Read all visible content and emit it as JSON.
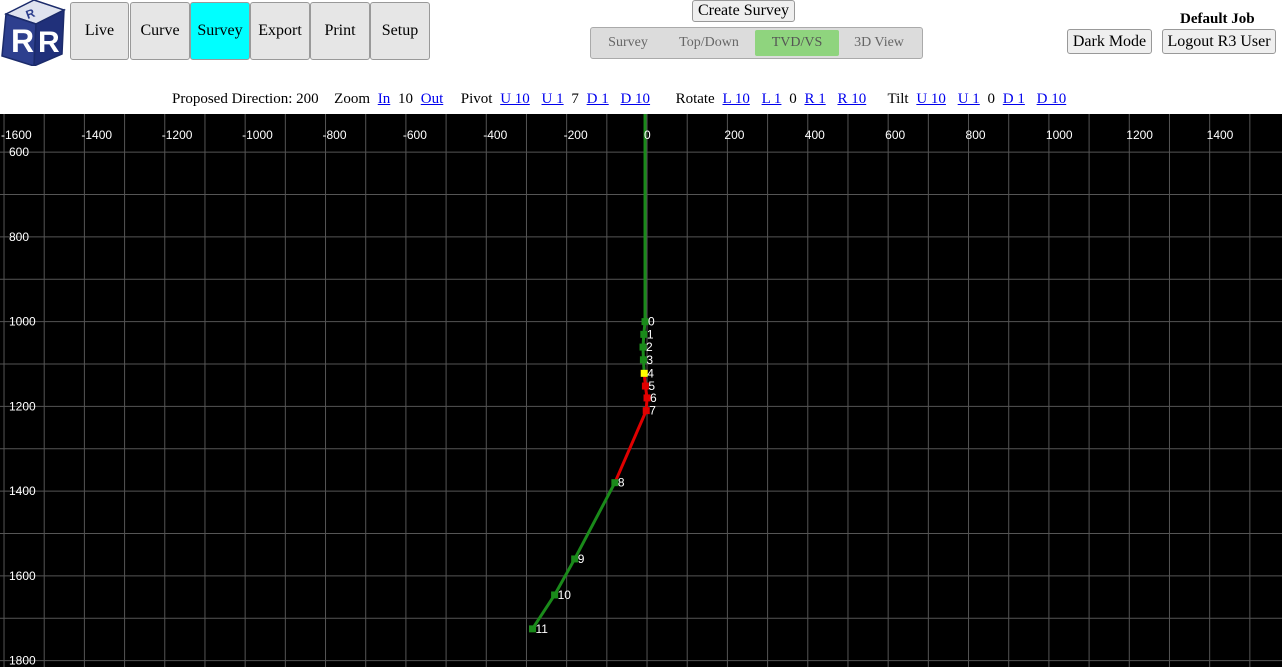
{
  "logo": {
    "letters": "RR"
  },
  "nav": {
    "items": [
      {
        "label": "Live",
        "active": false
      },
      {
        "label": "Curve",
        "active": false
      },
      {
        "label": "Survey",
        "active": true
      },
      {
        "label": "Export",
        "active": false
      },
      {
        "label": "Print",
        "active": false
      },
      {
        "label": "Setup",
        "active": false
      }
    ]
  },
  "toolbar": {
    "create_survey": "Create Survey",
    "views": [
      {
        "label": "Survey",
        "active": false
      },
      {
        "label": "Top/Down",
        "active": false
      },
      {
        "label": "TVD/VS",
        "active": true
      },
      {
        "label": "3D View",
        "active": false
      }
    ]
  },
  "header_right": {
    "job_title": "Default Job",
    "dark_mode": "Dark Mode",
    "logout": "Logout R3 User"
  },
  "controls": {
    "proposed_label": "Proposed Direction:",
    "proposed_value": "200",
    "zoom_label": "Zoom",
    "zoom_in": "In",
    "zoom_value": "10",
    "zoom_out": "Out",
    "pivot_label": "Pivot",
    "pivot_u10": "U 10",
    "pivot_u1": "U 1",
    "pivot_value": "7",
    "pivot_d1": "D 1",
    "pivot_d10": "D 10",
    "rotate_label": "Rotate",
    "rotate_l10": "L 10",
    "rotate_l1": "L 1",
    "rotate_value": "0",
    "rotate_r1": "R 1",
    "rotate_r10": "R 10",
    "tilt_label": "Tilt",
    "tilt_u10": "U 10",
    "tilt_u1": "U 1",
    "tilt_value": "0",
    "tilt_d1": "D 1",
    "tilt_d10": "D 10"
  },
  "colors": {
    "grid": "#555555",
    "path_green": "#1a8a1a",
    "path_red": "#e00000",
    "highlight": "#ffff00",
    "label": "#ffffff",
    "active_nav": "#00ffff",
    "active_view": "#8fd47e"
  },
  "chart_data": {
    "type": "line",
    "x_ticks": [
      -1600,
      -1400,
      -1200,
      -1000,
      -800,
      -600,
      -400,
      -200,
      0,
      200,
      400,
      600,
      800,
      1000,
      1200,
      1400
    ],
    "y_ticks": [
      600,
      800,
      1000,
      1200,
      1400,
      1600,
      1800
    ],
    "xlim": [
      -1610,
      1580
    ],
    "ylim": [
      510,
      1815
    ],
    "grid": true,
    "lead_line": {
      "x": [
        -5,
        -5
      ],
      "y": [
        510,
        1000
      ]
    },
    "stations": [
      {
        "label": "0",
        "x": -5,
        "y": 1000,
        "color": "green"
      },
      {
        "label": "1",
        "x": -8,
        "y": 1030,
        "color": "green"
      },
      {
        "label": "2",
        "x": -10,
        "y": 1060,
        "color": "green"
      },
      {
        "label": "3",
        "x": -9,
        "y": 1090,
        "color": "green"
      },
      {
        "label": "4",
        "x": -7,
        "y": 1122,
        "color": "yellow"
      },
      {
        "label": "5",
        "x": -4,
        "y": 1152,
        "color": "red"
      },
      {
        "label": "6",
        "x": 0,
        "y": 1180,
        "color": "red"
      },
      {
        "label": "7",
        "x": -2,
        "y": 1210,
        "color": "red"
      },
      {
        "label": "8",
        "x": -80,
        "y": 1380,
        "color": "green"
      },
      {
        "label": "9",
        "x": -180,
        "y": 1560,
        "color": "green"
      },
      {
        "label": "10",
        "x": -230,
        "y": 1645,
        "color": "green"
      },
      {
        "label": "11",
        "x": -285,
        "y": 1725,
        "color": "green"
      }
    ]
  }
}
